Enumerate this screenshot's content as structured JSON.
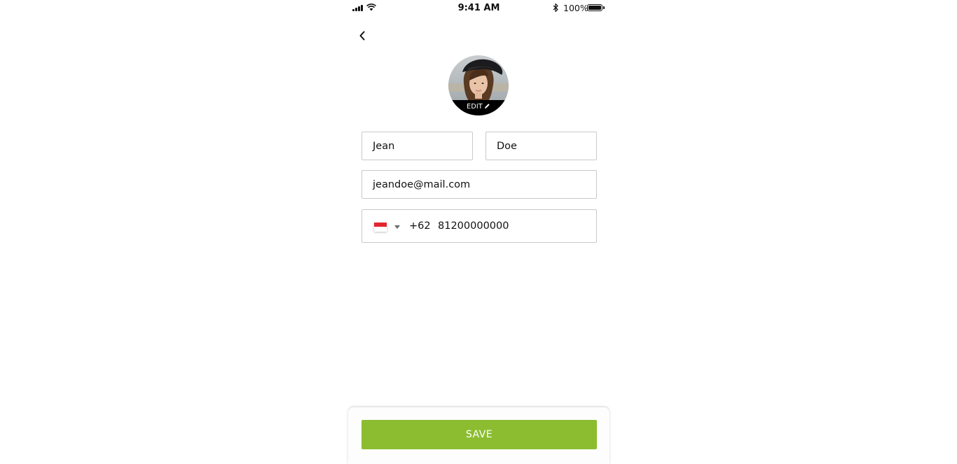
{
  "status_bar": {
    "time": "9:41 AM",
    "battery_percent": "100%",
    "battery_level": 1.0,
    "icons": [
      "signal-icon",
      "wifi-icon",
      "bluetooth-icon",
      "battery-icon"
    ]
  },
  "header": {
    "back_icon": "chevron-left-icon"
  },
  "profile": {
    "edit_label": "EDIT",
    "edit_icon": "pencil-icon"
  },
  "form": {
    "first_name": "Jean",
    "last_name": "Doe",
    "email": "jeandoe@mail.com",
    "phone": {
      "country_flag": "indonesia-flag",
      "dial_code": "+62",
      "number": "81200000000"
    }
  },
  "footer": {
    "save_label": "SAVE"
  },
  "colors": {
    "accent": "#8cbd31",
    "border": "#c9c9c9",
    "flag_red": "#e3262d"
  }
}
